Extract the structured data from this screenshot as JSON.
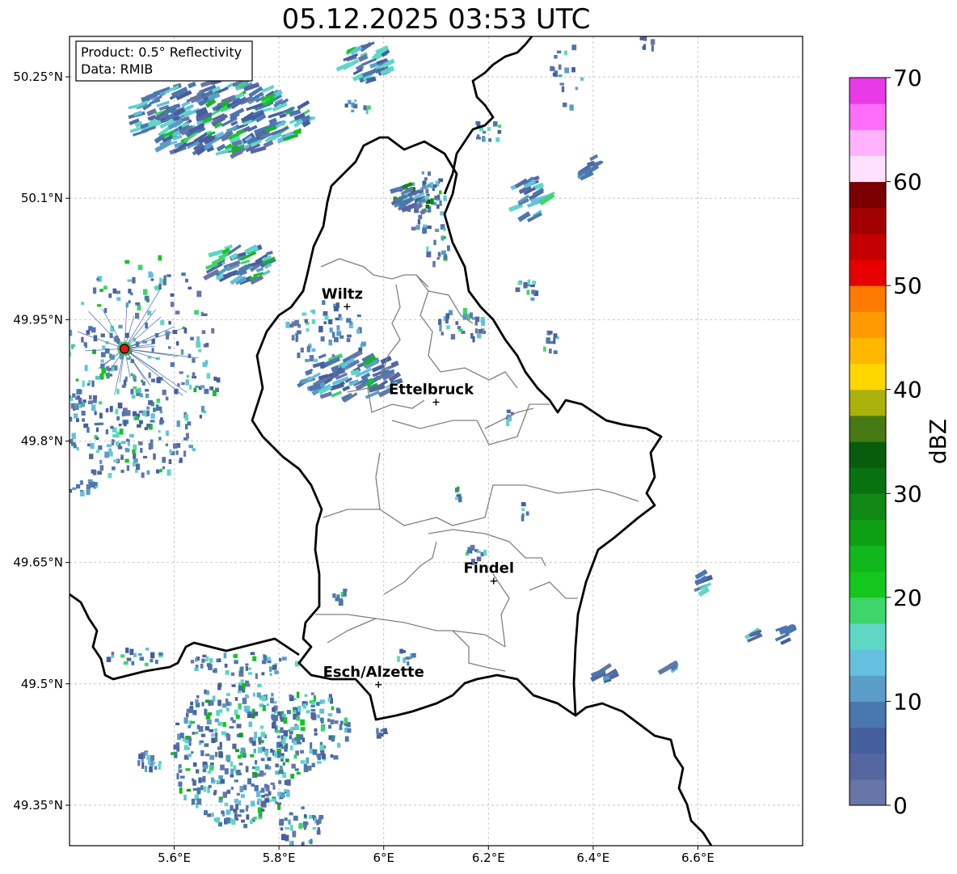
{
  "title": "05.12.2025 03:53 UTC",
  "info_box": {
    "product": "Product: 0.5° Reflectivity",
    "data": "Data: RMIB"
  },
  "lon_ticks": [
    {
      "value": 5.6,
      "label": "5.6°E"
    },
    {
      "value": 5.8,
      "label": "5.8°E"
    },
    {
      "value": 6.0,
      "label": "6°E"
    },
    {
      "value": 6.2,
      "label": "6.2°E"
    },
    {
      "value": 6.4,
      "label": "6.4°E"
    },
    {
      "value": 6.6,
      "label": "6.6°E"
    }
  ],
  "lat_ticks": [
    {
      "value": 50.25,
      "label": "50.25°N"
    },
    {
      "value": 50.1,
      "label": "50.1°N"
    },
    {
      "value": 49.95,
      "label": "49.95°N"
    },
    {
      "value": 49.8,
      "label": "49.8°N"
    },
    {
      "value": 49.65,
      "label": "49.65°N"
    },
    {
      "value": 49.5,
      "label": "49.5°N"
    },
    {
      "value": 49.35,
      "label": "49.35°N"
    }
  ],
  "extent": {
    "lon_min": 5.4,
    "lon_max": 6.8,
    "lat_min": 49.3,
    "lat_max": 50.3
  },
  "cities": [
    {
      "name": "Wiltz",
      "lon": 5.93,
      "lat": 49.966
    },
    {
      "name": "Ettelbruck",
      "lon": 6.1,
      "lat": 49.848
    },
    {
      "name": "Findel",
      "lon": 6.21,
      "lat": 49.627
    },
    {
      "name": "Esch/Alzette",
      "lon": 5.99,
      "lat": 49.499
    }
  ],
  "radar_site": {
    "lon": 5.505,
    "lat": 49.914,
    "color": "#e8131b"
  },
  "colorbar": {
    "label": "dBZ",
    "min": 0,
    "max": 70,
    "ticks": [
      {
        "value": 0,
        "label": "0"
      },
      {
        "value": 10,
        "label": "10"
      },
      {
        "value": 20,
        "label": "20"
      },
      {
        "value": 30,
        "label": "30"
      },
      {
        "value": 40,
        "label": "40"
      },
      {
        "value": 50,
        "label": "50"
      },
      {
        "value": 60,
        "label": "60"
      },
      {
        "value": 70,
        "label": "70"
      }
    ],
    "colors": [
      "#6676a8",
      "#5567a0",
      "#455f9e",
      "#4b77b0",
      "#5a9dc6",
      "#64c0dc",
      "#5ed7c5",
      "#3ed56a",
      "#13c71f",
      "#11b81b",
      "#0f9f15",
      "#0f8814",
      "#0a7110",
      "#075d0b",
      "#477a14",
      "#aab20b",
      "#ffd600",
      "#ffb700",
      "#ff9b00",
      "#ff7a00",
      "#e60000",
      "#c40000",
      "#a00000",
      "#7a0000",
      "#ffe1ff",
      "#ffb3ff",
      "#ff6dfa",
      "#e93ae7"
    ]
  },
  "colors": {
    "country_border": "#000000",
    "canton_border": "#808080",
    "grid": "#bdbdbd"
  }
}
